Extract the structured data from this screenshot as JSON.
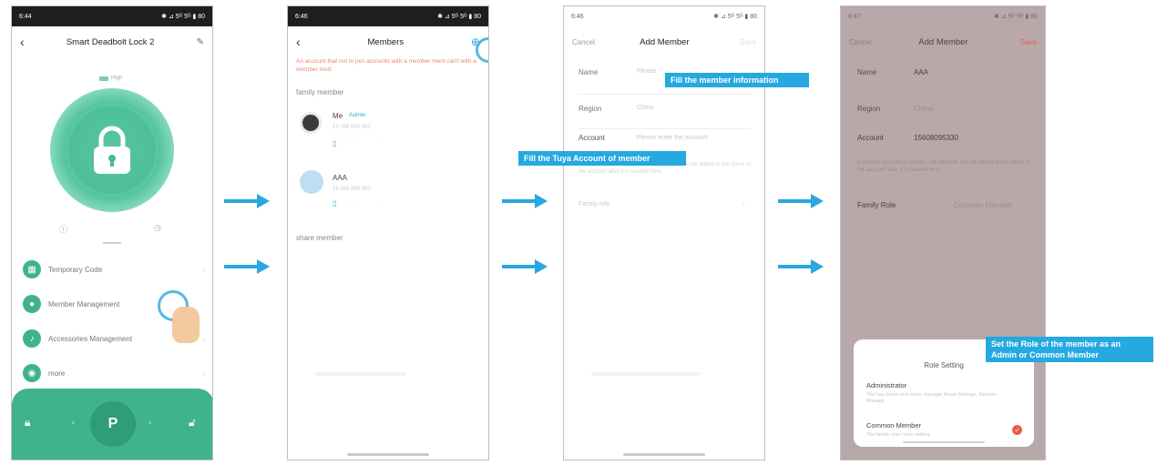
{
  "screen1": {
    "status_time": "6:44",
    "status_icons": "✱ ⊿ 5ᴳ 5ᴳ ▮ 80",
    "back_symbol": "‹",
    "title": "Smart Deadbolt Lock 2",
    "battery_text": "High",
    "menu": [
      {
        "label": "Temporary Code",
        "icon": "grid-icon"
      },
      {
        "label": "Member Management",
        "icon": "person-icon"
      },
      {
        "label": "Accessories Management",
        "icon": "key-icon"
      },
      {
        "label": "more",
        "icon": "dot-icon"
      }
    ],
    "unlock_symbol": "P",
    "brand_color": "#3fb38a"
  },
  "screen2": {
    "status_time": "6:46",
    "status_icons": "✱ ⊿ 5ᴳ 5ᴳ ▮ 80",
    "back_symbol": "‹",
    "title": "Members",
    "warning": "An account that not to join accounts with a member ment can't with a member mod.",
    "family_header": "family member",
    "members": [
      {
        "name": "Me",
        "tag": "Admin",
        "sub": "13 788 000 000"
      },
      {
        "name": "AAA",
        "tag": "",
        "sub": "18 888 880 000"
      }
    ],
    "share_header": "share member",
    "warning_color": "#e8896c"
  },
  "screen3": {
    "status_time": "6:46",
    "status_icons": "✱ ⊿ 5ᴳ 5ᴳ ▮ 80",
    "cancel": "Cancel",
    "title": "Add Member",
    "save": "Save",
    "name_label": "Name",
    "name_placeholder": "Please",
    "region_label": "Region",
    "region_value": "China",
    "account_label": "Account",
    "account_placeholder": "Please enter the account",
    "note": "If another account is needed, the member can be added to the home of the account after it is created here.",
    "family_role_label": "Family role",
    "callout_member": "Fill the member information",
    "callout_account": "Fill the Tuya Account of member"
  },
  "screen4": {
    "status_time": "6:47",
    "status_icons": "✱ ⊿ 5ᴳ 5ᴳ ▮ 80",
    "cancel": "Cancel",
    "title": "Add Member",
    "save": "Save",
    "name_label": "Name",
    "name_value": "AAA",
    "region_label": "Region",
    "region_value": "China",
    "account_label": "Account",
    "account_value": "15608095330",
    "note": "If another account is needed, the member can be added to the home of the account after it is created here.",
    "family_role_label": "Family Role",
    "family_role_value": "Common Member",
    "sheet_title": "Role Setting",
    "roles": [
      {
        "name": "Administrator",
        "desc": "The has home and room, manage Smart Settings, Remote Manage"
      },
      {
        "name": "Common Member",
        "desc": "The family user room setting"
      }
    ],
    "callout_role": "Set the Role of the member as an Admin or Common Member",
    "save_color": "#e5604a",
    "overlay_color": "#b8a8aa"
  }
}
